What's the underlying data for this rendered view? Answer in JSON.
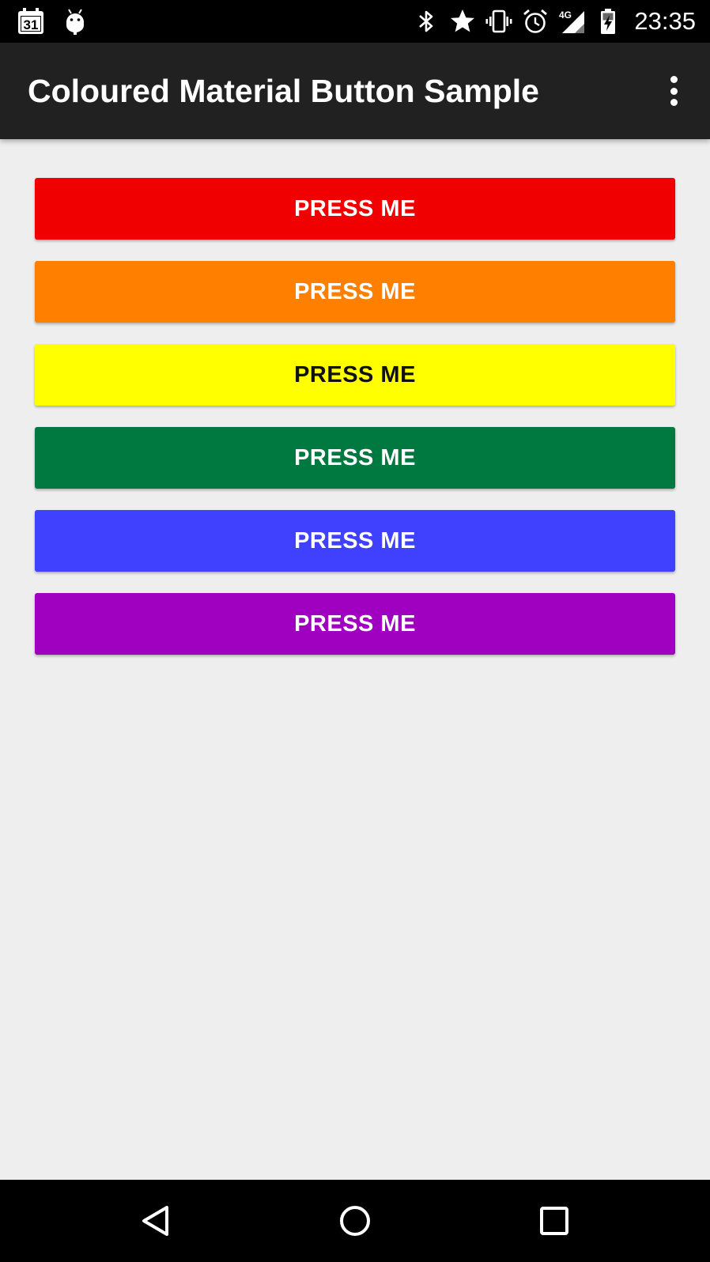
{
  "status_bar": {
    "time": "23:35",
    "calendar_day": "31",
    "network_type": "4G",
    "left_icons": [
      "calendar-icon",
      "android-debug-icon"
    ],
    "right_icons": [
      "bluetooth-icon",
      "star-icon",
      "vibrate-icon",
      "alarm-icon",
      "signal-4g-icon",
      "battery-charging-icon"
    ]
  },
  "app_bar": {
    "title": "Coloured Material Button Sample",
    "overflow_icon": "more-vert-icon"
  },
  "buttons": [
    {
      "label": "PRESS ME",
      "bg": "#f00000",
      "text_color": "#ffffff"
    },
    {
      "label": "PRESS ME",
      "bg": "#ff7f00",
      "text_color": "#ffffff"
    },
    {
      "label": "PRESS ME",
      "bg": "#ffff00",
      "text_color": "#111111"
    },
    {
      "label": "PRESS ME",
      "bg": "#007940",
      "text_color": "#ffffff"
    },
    {
      "label": "PRESS ME",
      "bg": "#4040ff",
      "text_color": "#ffffff"
    },
    {
      "label": "PRESS ME",
      "bg": "#a000c0",
      "text_color": "#ffffff"
    }
  ],
  "nav_bar": {
    "icons": [
      "back-icon",
      "home-icon",
      "recents-icon"
    ]
  },
  "colors": {
    "status_bar_bg": "#000000",
    "app_bar_bg": "#212121",
    "content_bg": "#eeeeee",
    "nav_bar_bg": "#000000"
  }
}
